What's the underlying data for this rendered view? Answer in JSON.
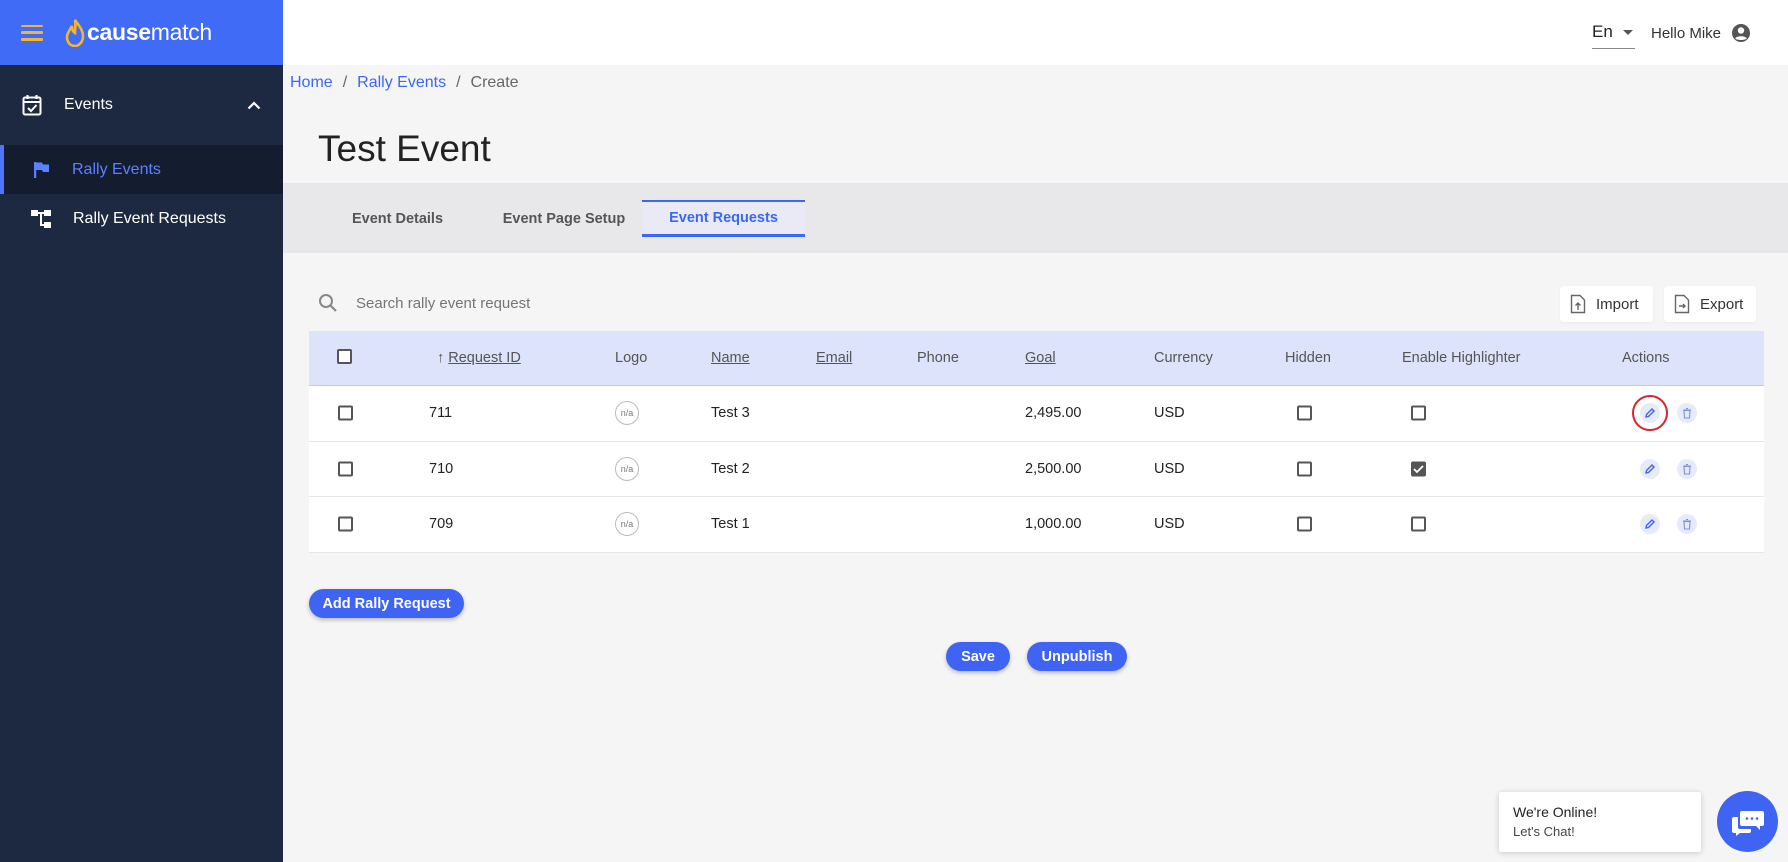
{
  "brand": {
    "logo_text_bold": "cause",
    "logo_text_rest": "match"
  },
  "sidebar": {
    "group": {
      "label": "Events"
    },
    "items": [
      {
        "label": "Rally Events",
        "active": true,
        "icon": "flag-icon"
      },
      {
        "label": "Rally Event Requests",
        "active": false,
        "icon": "tree-icon"
      }
    ]
  },
  "header": {
    "language": "En",
    "greeting": "Hello Mike"
  },
  "breadcrumb": {
    "home": "Home",
    "parent": "Rally Events",
    "current": "Create",
    "sep": "/"
  },
  "page": {
    "title": "Test Event"
  },
  "tabs": [
    {
      "label": "Event Details",
      "active": false
    },
    {
      "label": "Event Page Setup",
      "active": false
    },
    {
      "label": "Event Requests",
      "active": true
    }
  ],
  "search": {
    "placeholder": "Search rally event request"
  },
  "toolbar": {
    "import_label": "Import",
    "export_label": "Export"
  },
  "table": {
    "columns": {
      "request_id": "Request ID",
      "logo": "Logo",
      "name": "Name",
      "email": "Email",
      "phone": "Phone",
      "goal": "Goal",
      "currency": "Currency",
      "hidden": "Hidden",
      "enable_highlighter": "Enable Highlighter",
      "actions": "Actions"
    },
    "rows": [
      {
        "id": "711",
        "logo": "n/a",
        "name": "Test 3",
        "email": "",
        "phone": "",
        "goal": "2,495.00",
        "currency": "USD",
        "hidden": false,
        "highlighter": false
      },
      {
        "id": "710",
        "logo": "n/a",
        "name": "Test 2",
        "email": "",
        "phone": "",
        "goal": "2,500.00",
        "currency": "USD",
        "hidden": false,
        "highlighter": true
      },
      {
        "id": "709",
        "logo": "n/a",
        "name": "Test 1",
        "email": "",
        "phone": "",
        "goal": "1,000.00",
        "currency": "USD",
        "hidden": false,
        "highlighter": false
      }
    ]
  },
  "buttons": {
    "add": "Add Rally Request",
    "save": "Save",
    "unpublish": "Unpublish"
  },
  "chat": {
    "line1": "We're Online!",
    "line2": "Let's Chat!"
  },
  "colors": {
    "primary": "#3f64f3",
    "sidebar": "#1d2940",
    "accent": "#f7b52b",
    "highlight_ring": "#d9232e"
  }
}
